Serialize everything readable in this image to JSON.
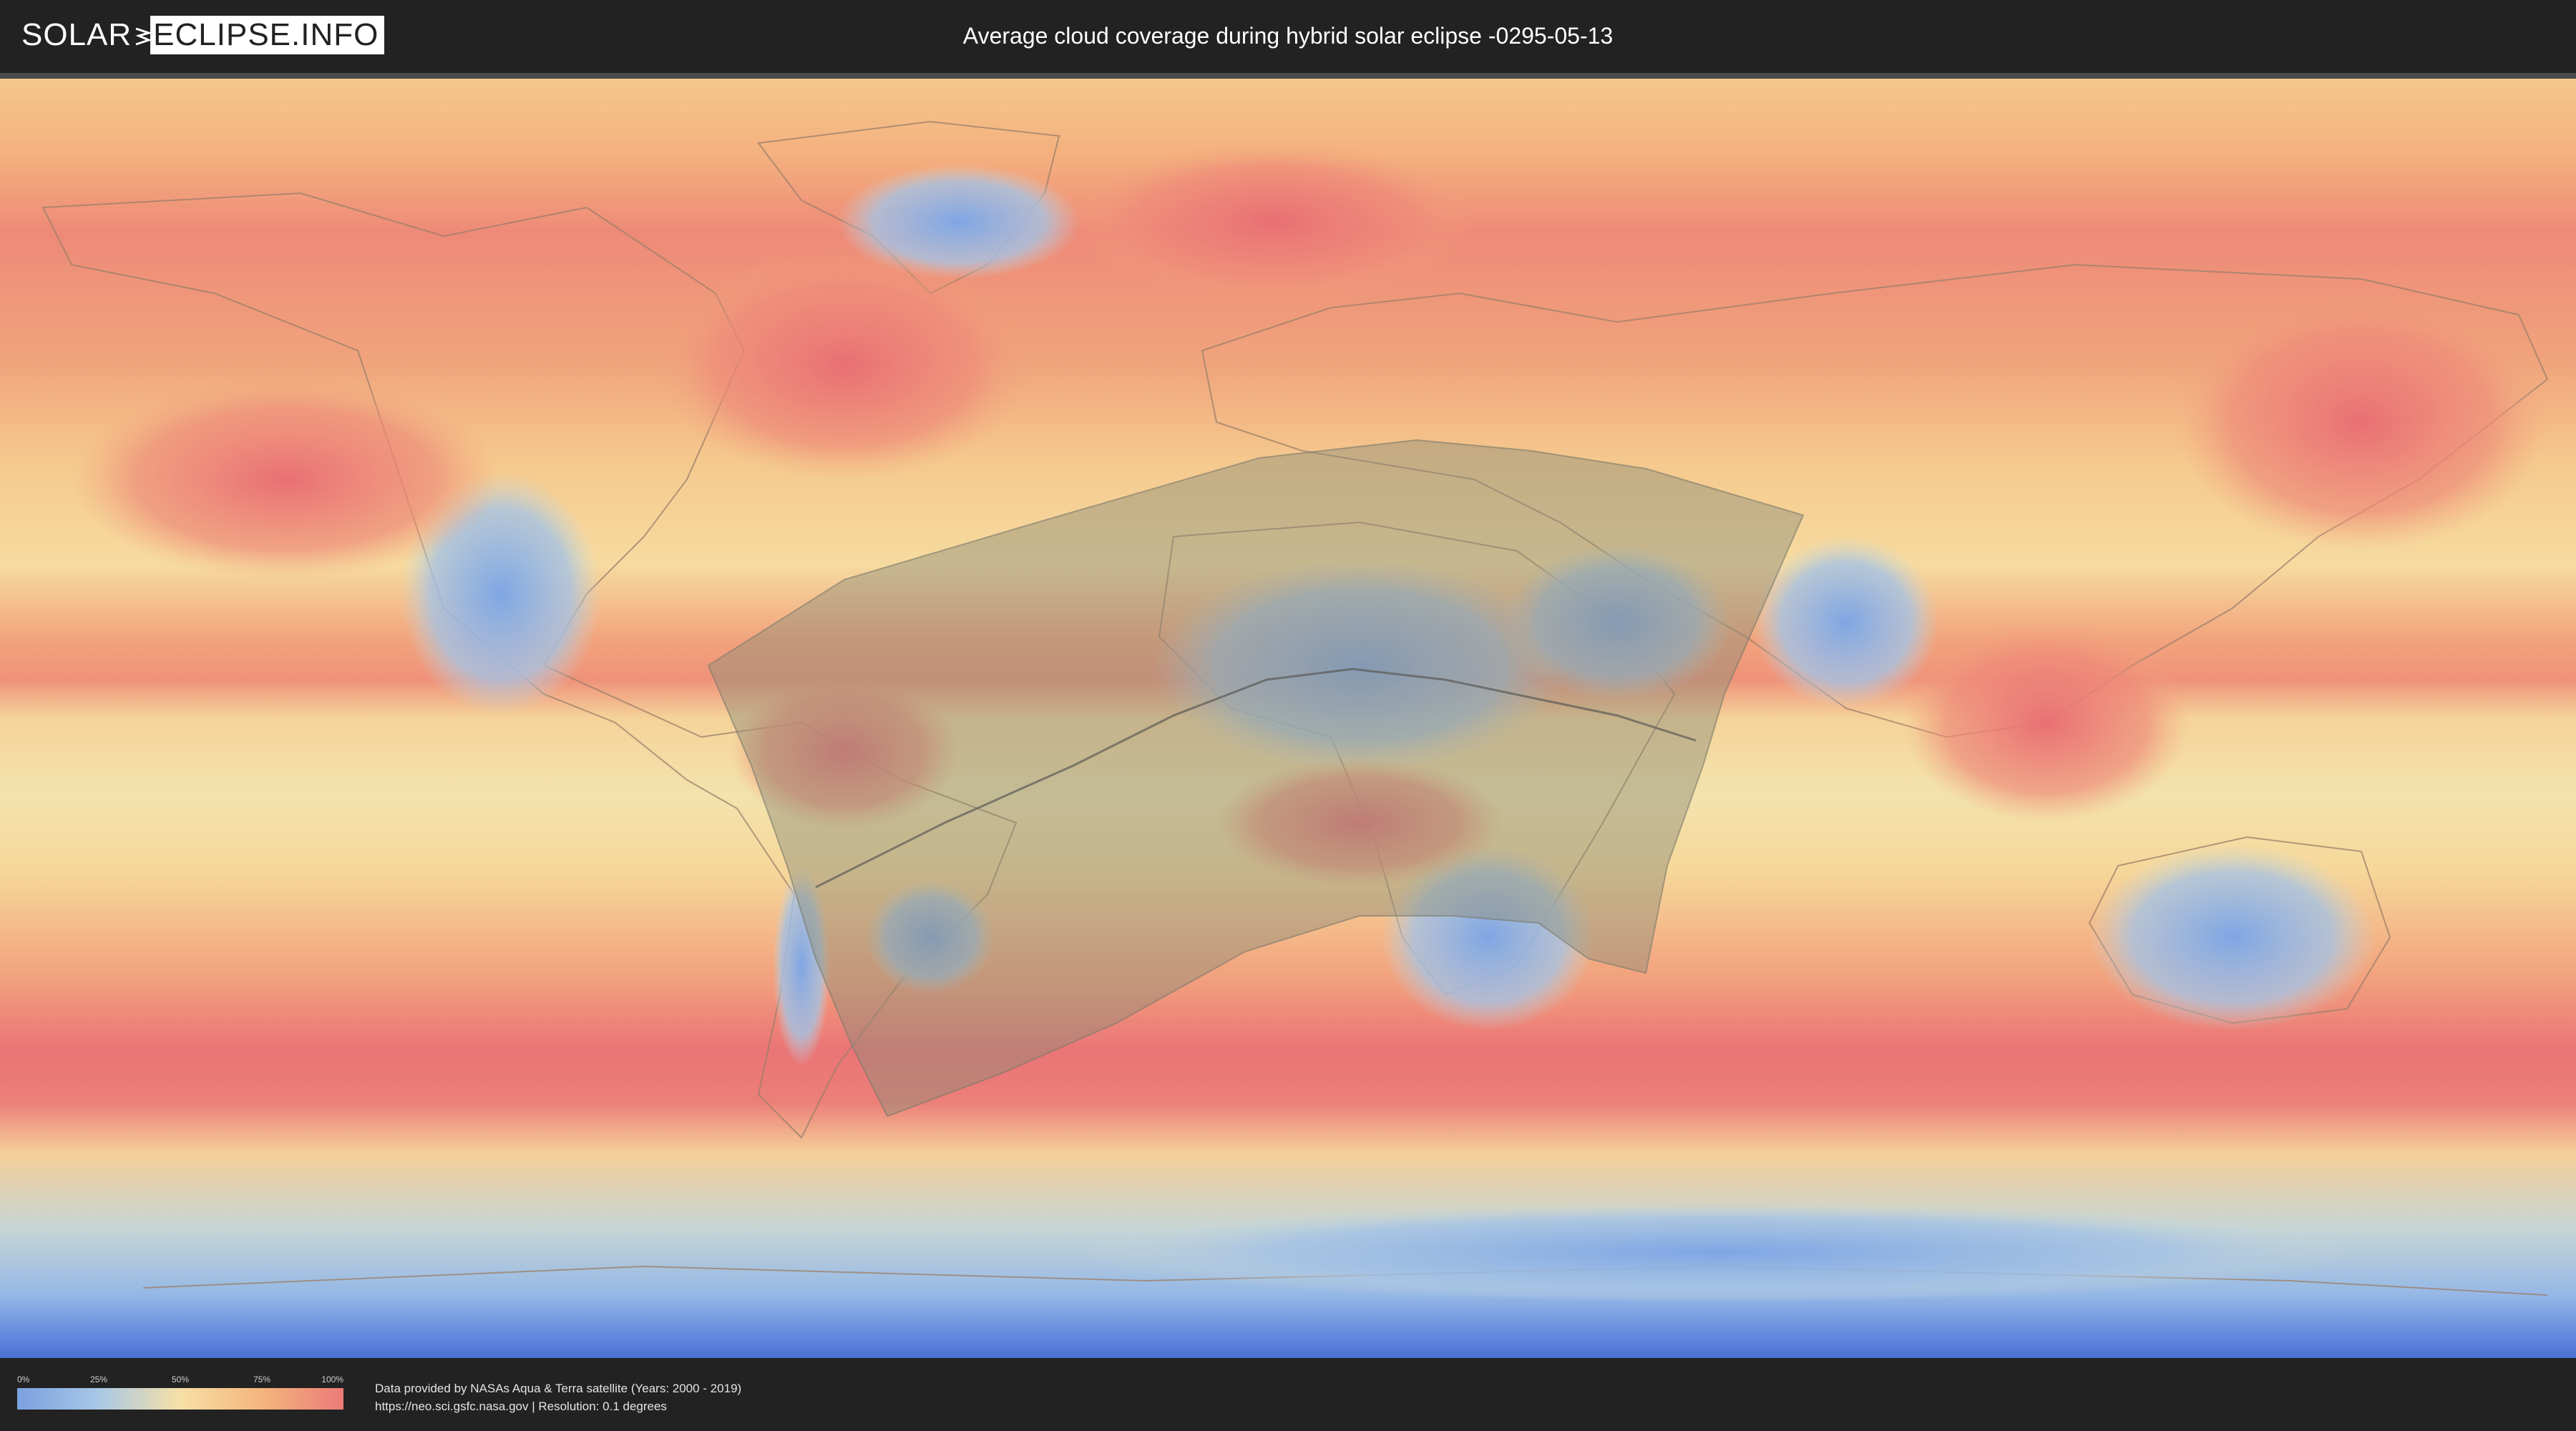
{
  "header": {
    "logo_left": "SOLAR",
    "logo_right": "ECLIPSE.INFO",
    "title": "Average cloud coverage during hybrid solar eclipse -0295-05-13"
  },
  "legend": {
    "ticks": [
      "0%",
      "25%",
      "50%",
      "75%",
      "100%"
    ],
    "colors": [
      "#7aa0e0",
      "#a9c8e6",
      "#f6e0a6",
      "#f4b57d",
      "#ec7b78"
    ]
  },
  "footer": {
    "credit_line_1": "Data provided by NASAs Aqua & Terra satellite (Years: 2000 - 2019)",
    "credit_line_2": "https://neo.sci.gsfc.nasa.gov | Resolution: 0.1 degrees"
  },
  "map": {
    "projection": "equirectangular",
    "theme_colors": {
      "ocean_clear": "#f6d79a",
      "cloudy": "#ec7b78",
      "clear": "#8fb4e6",
      "eclipse_overlay": "#8c8c78"
    }
  }
}
